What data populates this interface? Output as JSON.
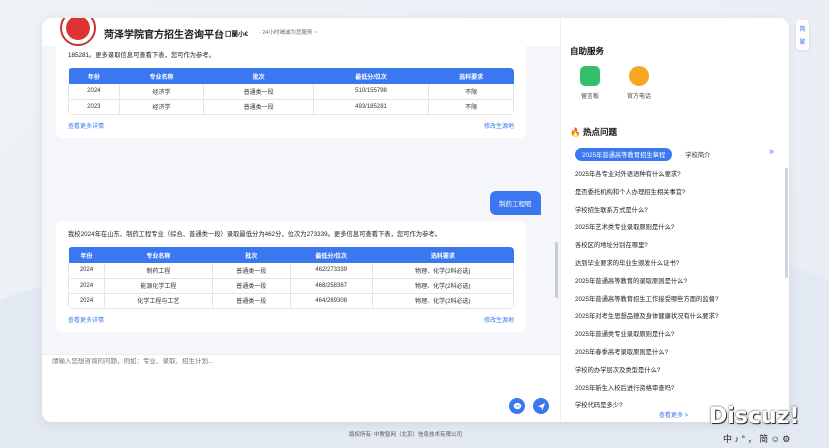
{
  "header": {
    "brand": "菏泽学院官方招生咨询平台",
    "assistant": "囗蘭小€",
    "tagline": "· 24小时竭诚为您服务 ~"
  },
  "chat": {
    "card1": {
      "text": "185281。更多录取信息可查看下表，您可作为参考。",
      "columns": [
        "年份",
        "专业名称",
        "批次",
        "最低分/位次",
        "选科要求"
      ],
      "rows": [
        [
          "2024",
          "经济学",
          "普通类一段",
          "510/155798",
          "不限"
        ],
        [
          "2023",
          "经济学",
          "普通类一段",
          "493/185281",
          "不限"
        ]
      ],
      "more_link": "查看更多详情",
      "change_link": "修改生源地"
    },
    "user_message": "制药工程呢",
    "card2": {
      "text": "我校2024年在山东、制药工程专业（综合、普通类一段）录取最低分为462分，位次为273339。更多信息可查看下表，您可作为参考。",
      "columns": [
        "年份",
        "专业名称",
        "批次",
        "最低分/位次",
        "选科要求"
      ],
      "rows": [
        [
          "2024",
          "制药工程",
          "普通类一段",
          "462/273339",
          "物理、化学(2科必选)"
        ],
        [
          "2024",
          "能源化学工程",
          "普通类一段",
          "468/258367",
          "物理、化学(2科必选)"
        ],
        [
          "2024",
          "化学工程与工艺",
          "普通类一段",
          "464/269308",
          "物理、化学(2科必选)"
        ]
      ],
      "more_link": "查看更多详情",
      "change_link": "修改生源地"
    }
  },
  "input": {
    "placeholder": "請输入您想咨询的问题，例如：专业、录取、招生计划..."
  },
  "sidebar": {
    "self_service_title": "自助服务",
    "services": [
      {
        "label": "留言板",
        "icon": "message-board-icon",
        "color": "#34c06a"
      },
      {
        "label": "官方电话",
        "icon": "phone-icon",
        "color": "#f5a623"
      }
    ],
    "hot_title": "热点问题",
    "tabs": [
      "2025年普通高等教育招生章程",
      "学校简介"
    ],
    "questions": [
      "2025年各专业对外语语种有什么要求?",
      "是否委托机构和个人办理招生相关事宜?",
      "学校招生联系方式是什么?",
      "2025年艺术类专业录取原则是什么?",
      "各校区的地址分别在哪里?",
      "达到毕业要求的毕业生颁发什么证书?",
      "2025年普通高等教育的录取原则是什么?",
      "2025年普通高等教育招生工作接受哪些方面的监督?",
      "2025年对考生思想品德及身体健康状况有什么要求?",
      "2025年普通类专业录取原则是什么?",
      "2025年春季高考录取原则是什么?",
      "学校的办学层次及类型是什么?",
      "2025年新生入校后进行资格审查吗?",
      "学校代码是多少?"
    ],
    "more": "查看更多 >"
  },
  "lang": [
    "简",
    "繁"
  ],
  "footer": "版权所有: 中教智网（北京）信息技术有限公司",
  "watermark": {
    "logo": "Discuz!",
    "text": "中 ♪ ° ， 简 ☺ ⚙"
  },
  "colors": {
    "accent": "#3b78f0"
  }
}
